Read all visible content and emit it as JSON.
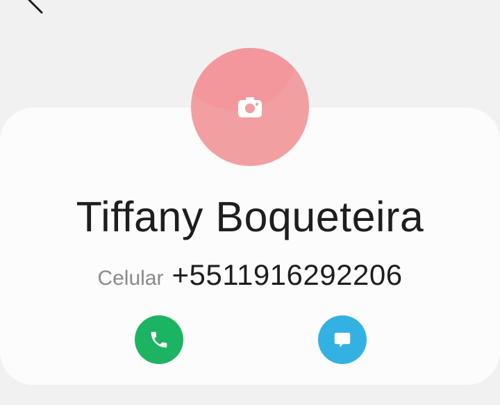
{
  "contact": {
    "name": "Tiffany Boqueteira",
    "phone_label": "Celular",
    "phone_number": "+5511916292206"
  },
  "icons": {
    "back": "back-arrow-icon",
    "avatar": "camera-icon",
    "call": "phone-icon",
    "message": "chat-bubble-icon"
  },
  "colors": {
    "background": "#f1f1f1",
    "card": "#fcfcfc",
    "avatar": "#f29fa1",
    "call_button": "#1cb462",
    "message_button": "#33b1e3",
    "name_text": "#1e1e1e",
    "label_text": "#8a8a8a"
  }
}
